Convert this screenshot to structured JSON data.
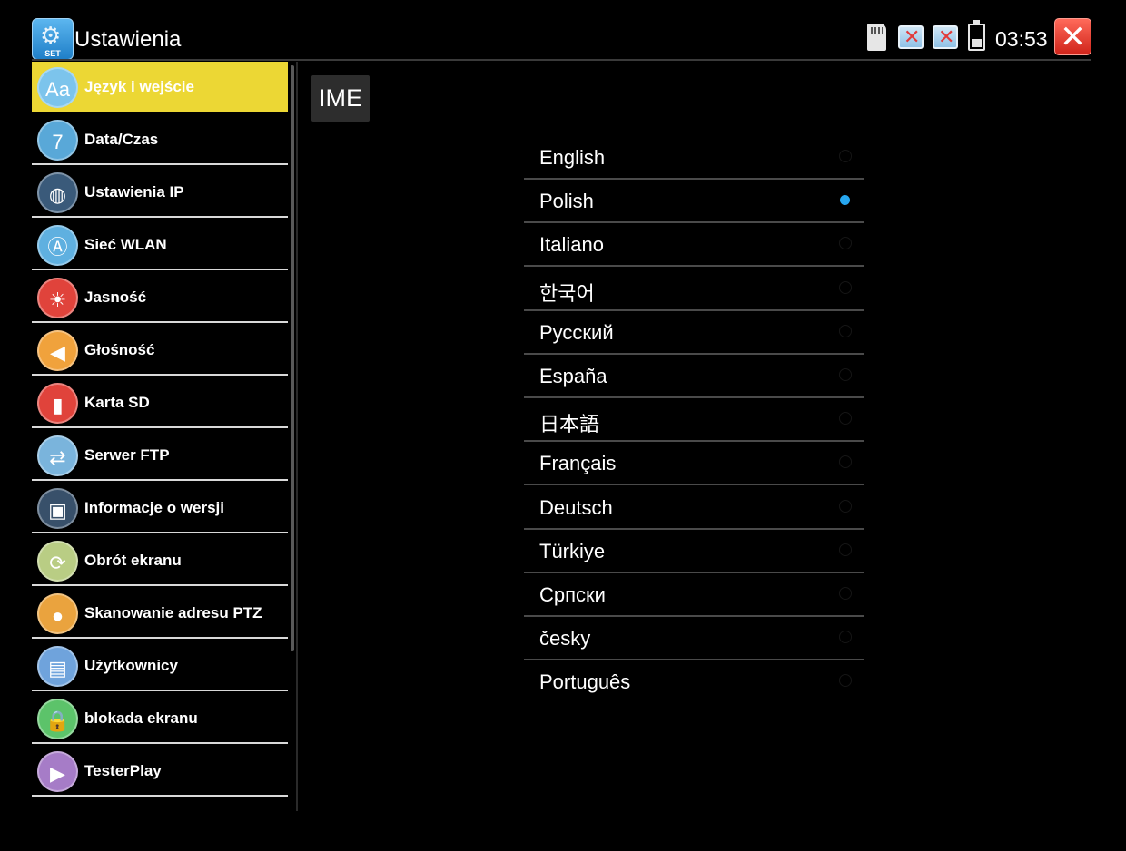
{
  "header": {
    "app_icon_label": "SET",
    "title": "Ustawienia",
    "clock": "03:53",
    "icons": [
      "gear-icon",
      "sd-card-icon",
      "network-disconnected-icon",
      "network-disconnected-icon",
      "battery-icon",
      "close-icon"
    ]
  },
  "sidebar": {
    "items": [
      {
        "label": "Język i wejście",
        "icon_text": "Aa",
        "icon": "language-icon",
        "color": "#7cc4ec",
        "active": true
      },
      {
        "label": "Data/Czas",
        "icon_text": "7",
        "icon": "calendar-icon",
        "color": "#59a8d8"
      },
      {
        "label": "Ustawienia IP",
        "icon_text": "◍",
        "icon": "globe-icon",
        "color": "#3a5a7a"
      },
      {
        "label": "Sieć WLAN",
        "icon_text": "Ⓐ",
        "icon": "antenna-icon",
        "color": "#5fb0e0"
      },
      {
        "label": "Jasność",
        "icon_text": "☀",
        "icon": "brightness-icon",
        "color": "#e0433b"
      },
      {
        "label": "Głośność",
        "icon_text": "◀",
        "icon": "volume-icon",
        "color": "#f0a23c"
      },
      {
        "label": "Karta SD",
        "icon_text": "▮",
        "icon": "sd-card-icon",
        "color": "#e0433b"
      },
      {
        "label": "Serwer FTP",
        "icon_text": "⇄",
        "icon": "ftp-icon",
        "color": "#7ab4dc"
      },
      {
        "label": "Informacje o wersji",
        "icon_text": "▣",
        "icon": "device-info-icon",
        "color": "#38506a"
      },
      {
        "label": "Obrót ekranu",
        "icon_text": "⟳",
        "icon": "rotate-icon",
        "color": "#b9cd84"
      },
      {
        "label": "Skanowanie adresu PTZ",
        "icon_text": "●",
        "icon": "ptz-camera-icon",
        "color": "#eaa33e"
      },
      {
        "label": "Użytkownicy",
        "icon_text": "▤",
        "icon": "contacts-icon",
        "color": "#6fa3dc"
      },
      {
        "label": "blokada ekranu",
        "icon_text": "🔒",
        "icon": "lock-icon",
        "color": "#5cc36a"
      },
      {
        "label": "TesterPlay",
        "icon_text": "▶",
        "icon": "play-icon",
        "color": "#a67cc7"
      }
    ]
  },
  "content": {
    "tab_label": "IME",
    "languages": [
      {
        "label": "English",
        "selected": false
      },
      {
        "label": "Polish",
        "selected": true
      },
      {
        "label": "Italiano",
        "selected": false
      },
      {
        "label": "한국어",
        "selected": false
      },
      {
        "label": "Русский",
        "selected": false
      },
      {
        "label": "España",
        "selected": false
      },
      {
        "label": "日本語",
        "selected": false
      },
      {
        "label": "Français",
        "selected": false
      },
      {
        "label": "Deutsch",
        "selected": false
      },
      {
        "label": "Türkiye",
        "selected": false
      },
      {
        "label": "Српски",
        "selected": false
      },
      {
        "label": "česky",
        "selected": false
      },
      {
        "label": "Português",
        "selected": false
      }
    ],
    "accent_color": "#27a7f0"
  }
}
